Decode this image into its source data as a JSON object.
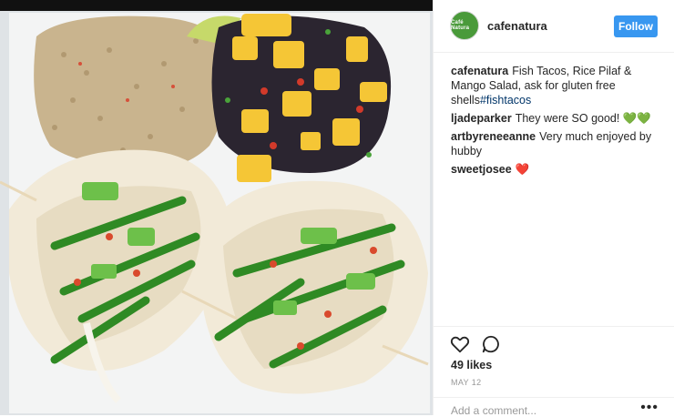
{
  "post": {
    "username": "cafenatura",
    "avatar_text": "Café Natura",
    "follow_label": "Follow"
  },
  "comments": [
    {
      "user": "cafenatura",
      "text": "Fish Tacos, Rice Pilaf & Mango Salad, ask for gluten free shells",
      "hashtag": "#fishtacos"
    },
    {
      "user": "ljadeparker",
      "text": "They were SO good!",
      "emoji": "💚💚"
    },
    {
      "user": "artbyreneeanne",
      "text": "Very much enjoyed by hubby"
    },
    {
      "user": "sweetjosee",
      "emoji": "❤️"
    }
  ],
  "engagement": {
    "likes": "49 likes",
    "date": "MAY 12",
    "add_comment_placeholder": "Add a comment...",
    "more": "•••"
  },
  "icons": {
    "like": "heart-outline-icon",
    "comment": "comment-bubble-icon",
    "more": "more-options-icon"
  },
  "colors": {
    "accent": "#3897f0",
    "avatar": "#4a9a3a",
    "heart": "#ed4956",
    "hashtag": "#003569"
  }
}
